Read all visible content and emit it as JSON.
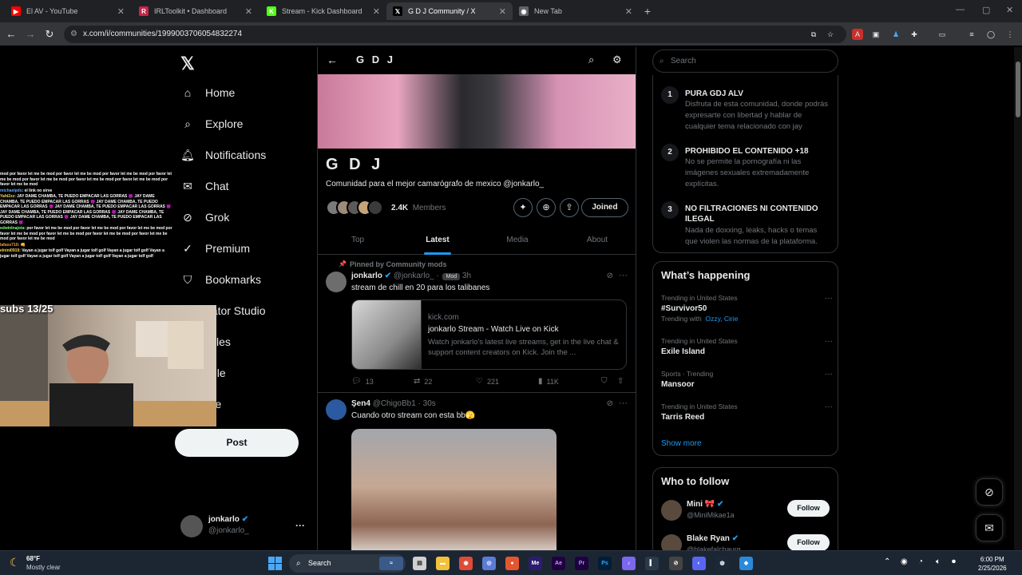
{
  "browser": {
    "tabs": [
      {
        "label": "El AV - YouTube",
        "favicon": "youtube-icon",
        "color": "#ff0000",
        "glyph": "▶",
        "active": false
      },
      {
        "label": "IRLToolkit • Dashboard",
        "favicon": "irltoolkit-icon",
        "color": "#c4264a",
        "glyph": "R",
        "active": false
      },
      {
        "label": "Stream - Kick Dashboard",
        "favicon": "kick-icon",
        "color": "#53fc18",
        "glyph": "K",
        "active": false
      },
      {
        "label": "G D J Community / X",
        "favicon": "x-icon",
        "color": "#000000",
        "glyph": "𝕏",
        "active": true
      },
      {
        "label": "New Tab",
        "favicon": "chrome-icon",
        "color": "#5f6368",
        "glyph": "◉",
        "active": false
      }
    ],
    "url": "x.com/i/communities/1999003706054832274"
  },
  "nav": {
    "items": [
      {
        "label": "Home",
        "icon": "home-icon"
      },
      {
        "label": "Explore",
        "icon": "search-icon"
      },
      {
        "label": "Notifications",
        "icon": "bell-icon"
      },
      {
        "label": "Chat",
        "icon": "mail-icon"
      },
      {
        "label": "Grok",
        "icon": "grok-icon"
      },
      {
        "label": "Premium",
        "icon": "premium-icon"
      },
      {
        "label": "Bookmarks",
        "icon": "bookmark-icon"
      },
      {
        "label": "eator Studio",
        "icon": "creator-studio-icon"
      },
      {
        "label": "ticles",
        "icon": "articles-icon"
      },
      {
        "label": "ofile",
        "icon": "profile-icon"
      },
      {
        "label": "ore",
        "icon": "more-icon"
      }
    ],
    "post_label": "Post",
    "account": {
      "name": "jonkarlo",
      "handle": "@jonkarlo_",
      "more": "···"
    }
  },
  "stream_overlay": {
    "subs": "subs 13/25",
    "chat": [
      {
        "user": "",
        "cls": "",
        "text": "mod por favor let me be mod por favor let me be mod por favor let me be mod por favor let me be mod por favor let me be mod por favor let me be mod por favor let me be mod por favor let me be mod"
      },
      {
        "user": "michaelpds",
        "cls": "u1",
        "text": ": el link no sirve"
      },
      {
        "user": "Yahi2zz",
        "cls": "u2",
        "text": ": JAY DAME CHAMBA, TE PUEDO EMPACAR LAS GORRAS 😈 JAY DAME CHAMBA, TE PUEDO EMPACAR LAS GORRAS 😈 JAY DAME CHAMBA, TE PUEDO EMPACAR LAS GORRAS 😈 JAY DAME CHAMBA, TE PUEDO EMPACAR LAS GORRAS 😈 JAY DAME CHAMBA, TE PUEDO EMPACAR LAS GORRAS 😈 JAY DAME CHAMBA, TE PUEDO EMPACAR LAS GORRAS 😈 JAY DAME CHAMBA, TE PUEDO EMPACAR LAS GORRAS 😈"
      },
      {
        "user": "edwinlnajota",
        "cls": "u3",
        "text": ": por favor let me be mod por favor let me be mod por favor let me be mod por favor let me be mod por favor let me be mod por favor let me be mod por favor let me be mod por favor let me be mod"
      },
      {
        "user": "lafaxs710",
        "cls": "u4",
        "text": ": 👊"
      },
      {
        "user": "elnini0919",
        "cls": "u2",
        "text": ": Vayan a jugar tolf golf Vayan a jugar tolf golf Vayan a jugar tolf golf Vayan a jugar tolf golf Vayan a jugar tolf golf Vayan a jugar tolf golf Vayan a jugar tolf golf"
      }
    ]
  },
  "community": {
    "header_title": "G D J",
    "name": "G D J",
    "description": "Comunidad para el mejor camarógrafo de mexico @jonkarlo_",
    "members_count": "2.4K",
    "members_label": "Members",
    "joined_label": "Joined",
    "tabs": [
      "Top",
      "Latest",
      "Media",
      "About"
    ],
    "active_tab": "Latest"
  },
  "tweets": {
    "pinned_label": "Pinned by Community mods",
    "t1": {
      "name": "jonkarlo",
      "handle": "@jonkarlo_ ·",
      "badge": "Mod",
      "time": "3h",
      "text": "stream de chill en 20 para los talibanes",
      "card_domain": "kick.com",
      "card_title": "jonkarlo Stream - Watch Live on Kick",
      "card_desc": "Watch jonkarlo's latest live streams, get in the live chat & support content creators on Kick. Join the ...",
      "replies": "13",
      "reposts": "22",
      "likes": "221",
      "views": "11K"
    },
    "t2": {
      "name": "Şen4",
      "handle": "@ChigoBb1 · 30s",
      "text": "Cuando otro stream con esta bb🫣"
    }
  },
  "sidebar": {
    "search_placeholder": "Search",
    "rules": [
      {
        "num": "1",
        "title": "PURA GDJ ALV",
        "desc": "Disfruta de esta comunidad, donde podrás expresarte con libertad y hablar de cualquier tema relacionado con jay"
      },
      {
        "num": "2",
        "title": "PROHIBIDO EL CONTENIDO +18",
        "desc": "No se permite la pornografía ni las imágenes sexuales extremadamente explícitas."
      },
      {
        "num": "3",
        "title": "NO FILTRACIONES NI CONTENIDO ILEGAL",
        "desc": "Nada de doxxing, leaks, hacks o temas que violen las normas de la plataforma."
      }
    ],
    "happening_title": "What’s happening",
    "trends": [
      {
        "meta": "Trending in United States",
        "title": "#Survivor50",
        "with_label": "Trending with",
        "with": "Ozzy, Cirie"
      },
      {
        "meta": "Trending in United States",
        "title": "Exile Island"
      },
      {
        "meta": "Sports · Trending",
        "title": "Mansoor"
      },
      {
        "meta": "Trending in United States",
        "title": "Tarris Reed"
      }
    ],
    "show_more": "Show more",
    "wtf_title": "Who to follow",
    "follow": [
      {
        "name": "Mini 🎀",
        "handle": "@MiniMikae1a",
        "btn": "Follow"
      },
      {
        "name": "Blake Ryan",
        "handle": "@blakefalchaurg",
        "btn": "Follow"
      }
    ]
  },
  "taskbar": {
    "weather_temp": "68°F",
    "weather_desc": "Mostly clear",
    "search_label": "Search",
    "time": "6:00 PM",
    "date": "2/25/2026"
  }
}
